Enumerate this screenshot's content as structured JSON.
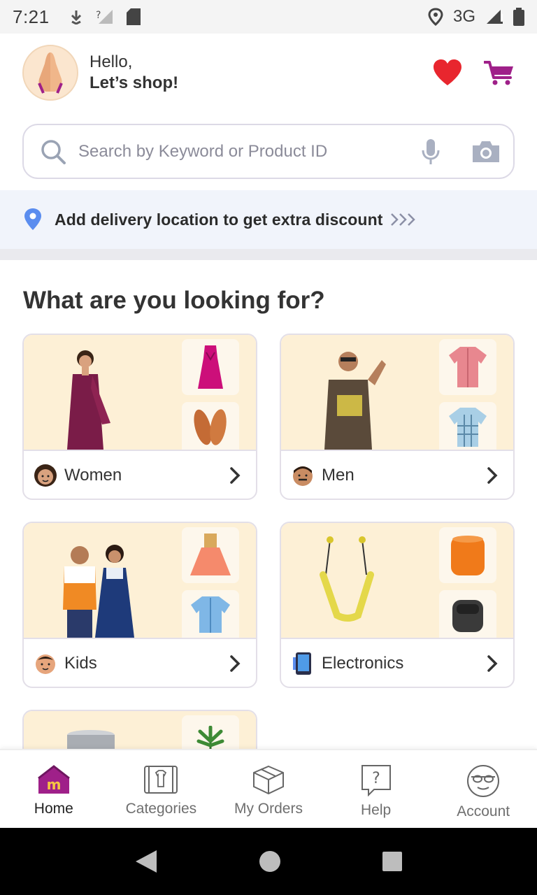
{
  "status_bar": {
    "time": "7:21",
    "network": "3G"
  },
  "header": {
    "hello": "Hello,",
    "subtitle": "Let’s shop!",
    "wishlist_icon": "heart-icon",
    "cart_icon": "cart-icon"
  },
  "search": {
    "placeholder": "Search by Keyword or Product ID"
  },
  "delivery": {
    "text": "Add delivery location to get extra discount"
  },
  "section_title": "What are you looking for?",
  "categories": [
    {
      "label": "Women",
      "icon": "woman-emoji-icon"
    },
    {
      "label": "Men",
      "icon": "man-emoji-icon"
    },
    {
      "label": "Kids",
      "icon": "baby-emoji-icon"
    },
    {
      "label": "Electronics",
      "icon": "phone-icon"
    }
  ],
  "bottom_nav": [
    {
      "label": "Home",
      "icon": "home-icon",
      "active": true
    },
    {
      "label": "Categories",
      "icon": "categories-icon",
      "active": false
    },
    {
      "label": "My Orders",
      "icon": "box-icon",
      "active": false
    },
    {
      "label": "Help",
      "icon": "help-icon",
      "active": false
    },
    {
      "label": "Account",
      "icon": "account-icon",
      "active": false
    }
  ],
  "colors": {
    "brand": "#9f2089",
    "heart": "#e8262e",
    "card_bg": "#fdf0d6",
    "banner_bg": "#f1f4fb"
  }
}
